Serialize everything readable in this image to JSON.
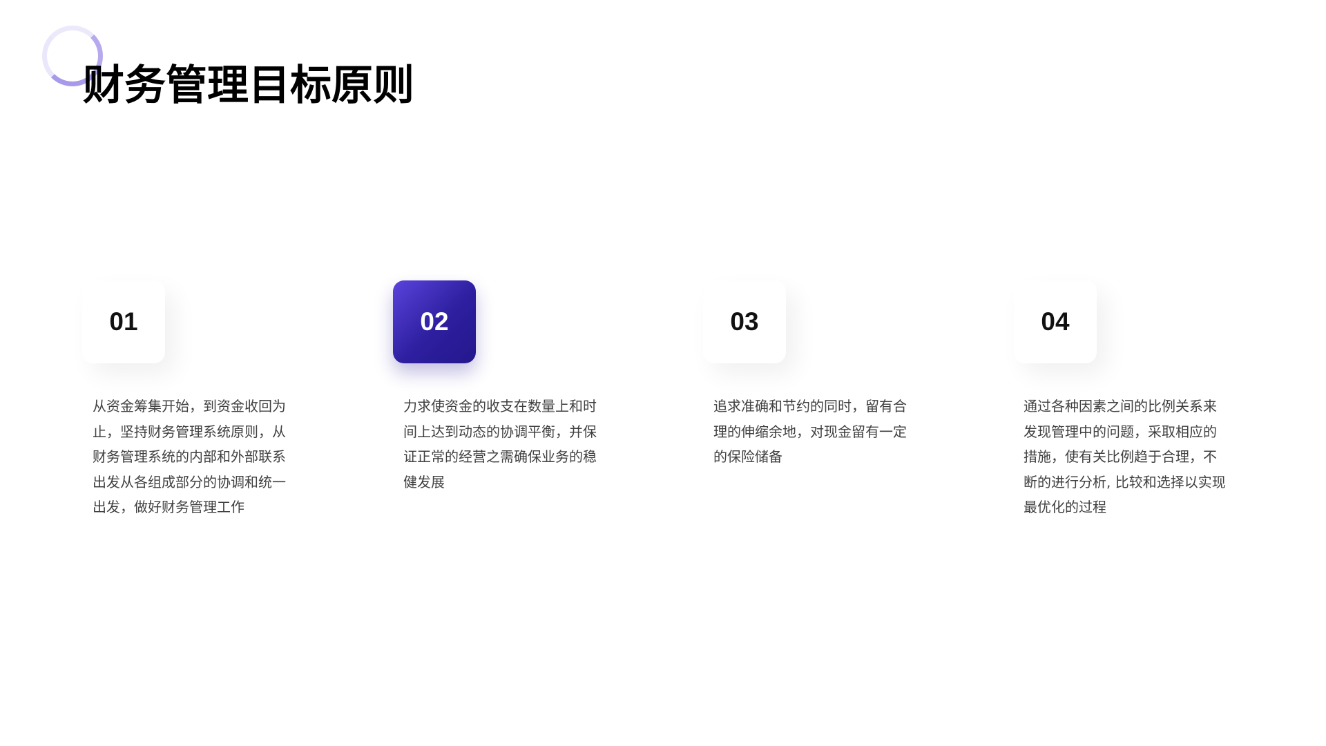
{
  "title": "财务管理目标原则",
  "accent_color": "#2d1f9f",
  "items": [
    {
      "number": "01",
      "text": "从资金筹集开始，到资金收回为止，坚持财务管理系统原则，从财务管理系统的内部和外部联系出发从各组成部分的协调和统一出发，做好财务管理工作"
    },
    {
      "number": "02",
      "text": "力求使资金的收支在数量上和时间上达到动态的协调平衡，并保证正常的经营之需确保业务的稳健发展"
    },
    {
      "number": "03",
      "text": " 追求准确和节约的同时，留有合理的伸缩余地，对现金留有一定的保险储备"
    },
    {
      "number": "04",
      "text": " 通过各种因素之间的比例关系来发现管理中的问题，采取相应的措施，使有关比例趋于合理，不断的进行分析, 比较和选择以实现最优化的过程"
    }
  ]
}
